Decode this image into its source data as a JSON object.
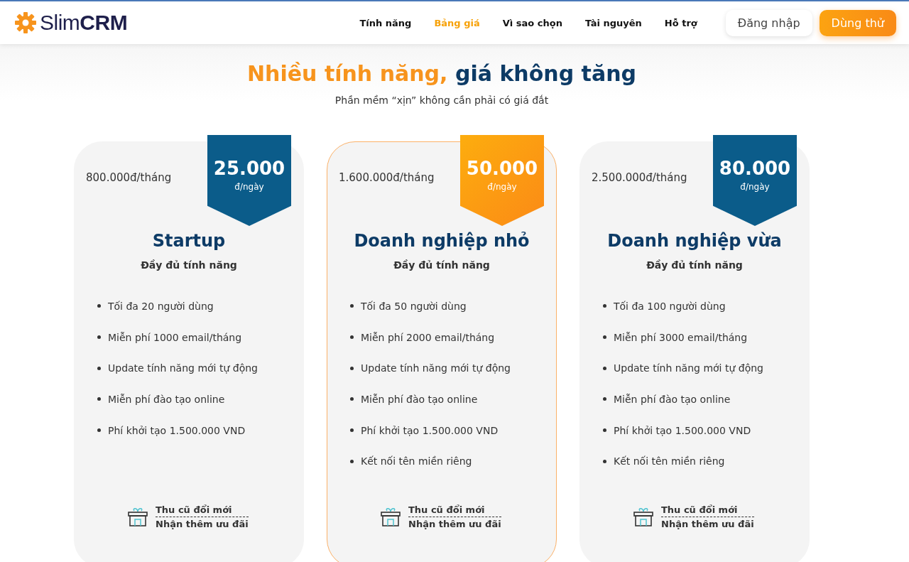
{
  "header": {
    "logo": {
      "light": "Slim",
      "bold": "CRM"
    },
    "nav": [
      {
        "label": "Tính năng",
        "selected": false
      },
      {
        "label": "Bảng giá",
        "selected": true
      },
      {
        "label": "Vì sao chọn",
        "selected": false
      },
      {
        "label": "Tài nguyên",
        "selected": false
      },
      {
        "label": "Hỗ trợ",
        "selected": false
      }
    ],
    "login": "Đăng nhập",
    "trial": "Dùng thử"
  },
  "hero": {
    "title_accent": "Nhiều tính năng,",
    "title_rest": "giá không tăng",
    "subtitle": "Phần mềm “xịn” không cần phải có giá đắt"
  },
  "plans": [
    {
      "monthly": "800.000đ/tháng",
      "daily": "25.000",
      "daily_unit": "đ/ngày",
      "highlighted": false,
      "name": "Startup",
      "tagline": "Đầy đủ tính năng",
      "features": [
        "Tối đa 20 người dùng",
        "Miễn phí 1000 email/tháng",
        "Update tính năng mới tự động",
        "Miễn phí đào tạo online",
        "Phí khởi tạo 1.500.000 VND"
      ],
      "promo": [
        "Thu cũ đổi mới",
        "Nhận thêm ưu đãi"
      ]
    },
    {
      "monthly": "1.600.000đ/tháng",
      "daily": "50.000",
      "daily_unit": "đ/ngày",
      "highlighted": true,
      "name": "Doanh nghiệp nhỏ",
      "tagline": "Đầy đủ tính năng",
      "features": [
        "Tối đa 50 người dùng",
        "Miễn phí 2000 email/tháng",
        "Update tính năng mới tự động",
        "Miễn phí đào tạo online",
        "Phí khởi tạo 1.500.000 VND",
        "Kết nối tên miền riêng"
      ],
      "promo": [
        "Thu cũ đổi mới",
        "Nhận thêm ưu đãi"
      ]
    },
    {
      "monthly": "2.500.000đ/tháng",
      "daily": "80.000",
      "daily_unit": "đ/ngày",
      "highlighted": false,
      "name": "Doanh nghiệp vừa",
      "tagline": "Đầy đủ tính năng",
      "features": [
        "Tối đa 100 người dùng",
        "Miễn phí 3000 email/tháng",
        "Update tính năng mới tự động",
        "Miễn phí đào tạo online",
        "Phí khởi tạo 1.500.000 VND",
        "Kết nối tên miền riêng"
      ],
      "promo": [
        "Thu cũ đổi mới",
        "Nhận thêm ưu đãi"
      ]
    }
  ]
}
